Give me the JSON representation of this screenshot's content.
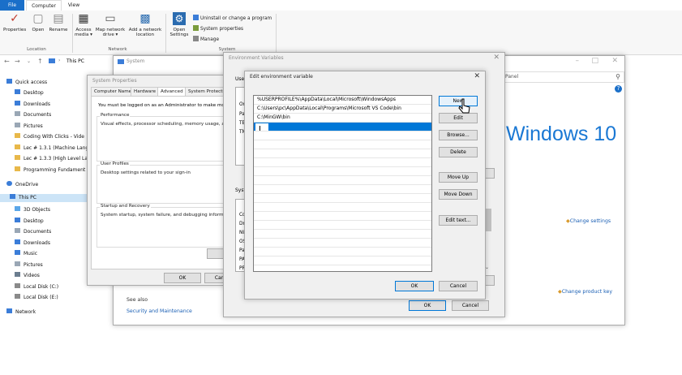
{
  "ribbon": {
    "tabs": {
      "file": "File",
      "computer": "Computer",
      "view": "View"
    },
    "buttons": {
      "properties": "Properties",
      "open": "Open",
      "rename": "Rename",
      "access_media": "Access media ▾",
      "map_drive": "Map network drive ▾",
      "add_location": "Add a network location",
      "open_settings": "Open Settings",
      "uninstall": "Uninstall or change a program",
      "system_properties": "System properties",
      "manage": "Manage"
    },
    "groups": {
      "location": "Location",
      "network": "Network",
      "system": "System"
    }
  },
  "address": {
    "path": "This PC"
  },
  "nav": {
    "quick_access": "Quick access",
    "items": [
      "Desktop",
      "Downloads",
      "Documents",
      "Pictures",
      "Coding With Clicks - Vide",
      "Lec # 1.3.1 (Machine Lang",
      "Lec # 1.3.3 (High Level Lar",
      "Programming Fundament"
    ],
    "onedrive": "OneDrive",
    "this_pc": "This PC",
    "pc_items": [
      "3D Objects",
      "Desktop",
      "Documents",
      "Downloads",
      "Music",
      "Pictures",
      "Videos",
      "Local Disk (C:)",
      "Local Disk (E:)"
    ],
    "network": "Network"
  },
  "system_window": {
    "title": "System",
    "search_text": "Panel",
    "windows_logo": "Windows 10",
    "change_settings": "Change settings",
    "change_product_key": "Change product key",
    "see_also": "See also",
    "security": "Security and Maintenance"
  },
  "system_properties": {
    "title": "System Properties",
    "tabs": [
      "Computer Name",
      "Hardware",
      "Advanced",
      "System Protection"
    ],
    "admin_note": "You must be logged on as an Administrator to make most of",
    "performance": {
      "label": "Performance",
      "text": "Visual effects, processor scheduling, memory usage, and"
    },
    "user_profiles": {
      "label": "User Profiles",
      "text": "Desktop settings related to your sign-in"
    },
    "startup": {
      "label": "Startup and Recovery",
      "text": "System startup, system failure, and debugging information"
    },
    "env_button": "Environ",
    "ok": "OK",
    "cancel": "Cancel"
  },
  "env_vars": {
    "title": "Environment Variables",
    "user_label": "User",
    "user_rows": [
      "On",
      "Pa",
      "TE",
      "TM"
    ],
    "system_label": "Syst",
    "system_rows": [
      "Co",
      "Dr",
      "NU",
      "OS",
      "Pa",
      "PA",
      "PR"
    ],
    "ok": "OK",
    "cancel": "Cancel"
  },
  "edit_env": {
    "title": "Edit environment variable",
    "entries": [
      "%USERPROFILE%\\AppData\\Local\\Microsoft\\WindowsApps",
      "C:\\Users\\pc\\AppData\\Local\\Programs\\Microsoft VS Code\\bin",
      "C:\\MinGW\\bin"
    ],
    "buttons": {
      "new": "New",
      "edit": "Edit",
      "browse": "Browse...",
      "delete": "Delete",
      "move_up": "Move Up",
      "move_down": "Move Down",
      "edit_text": "Edit text..."
    },
    "ok": "OK",
    "cancel": "Cancel"
  }
}
